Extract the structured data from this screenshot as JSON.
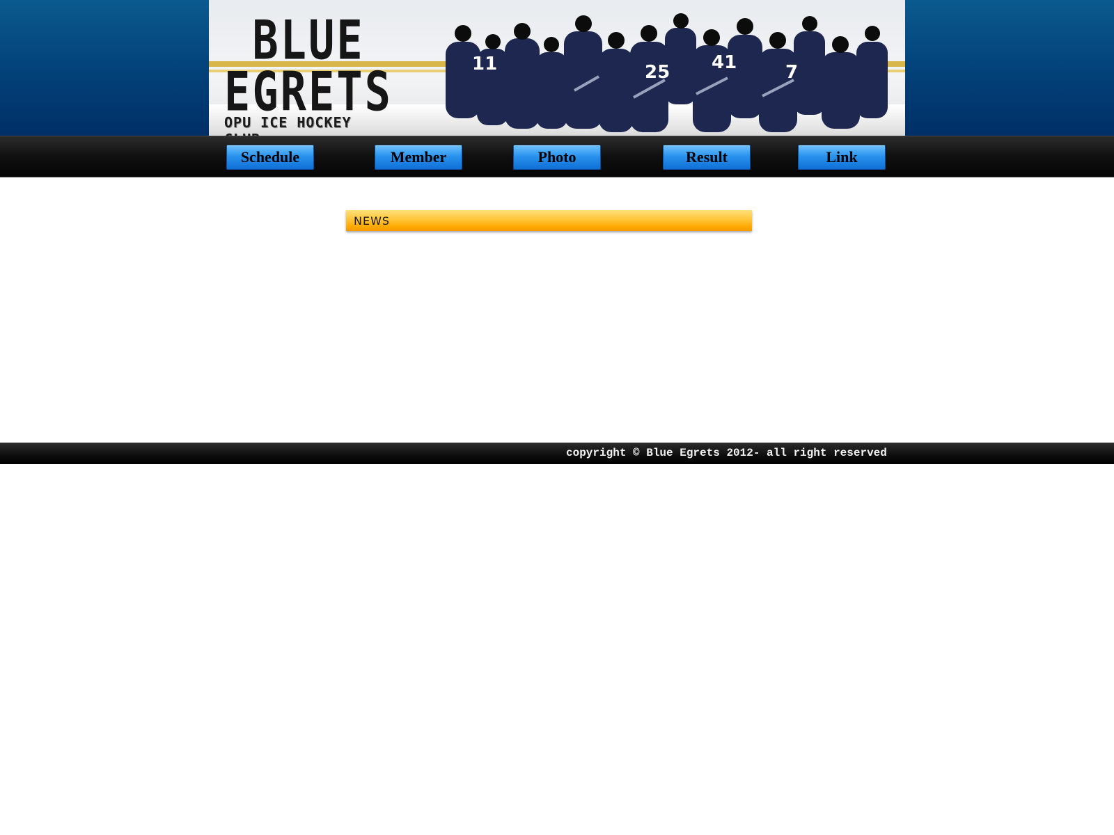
{
  "header": {
    "logo_line1": "BLUE",
    "logo_line2": "EGRETS",
    "logo_subtitle": "OPU ICE HOCKEY CLUB"
  },
  "nav": {
    "items": [
      {
        "label": "Schedule"
      },
      {
        "label": "Member"
      },
      {
        "label": "Photo"
      },
      {
        "label": "Result"
      },
      {
        "label": "Link"
      }
    ]
  },
  "news": {
    "heading": "NEWS"
  },
  "footer": {
    "copyright": "copyright © Blue Egrets 2012- all right reserved"
  },
  "colors": {
    "header_blue": "#03457c",
    "nav_button_blue": "#2a93ee",
    "news_orange": "#ffa800",
    "bar_black": "#0d0d0d"
  }
}
